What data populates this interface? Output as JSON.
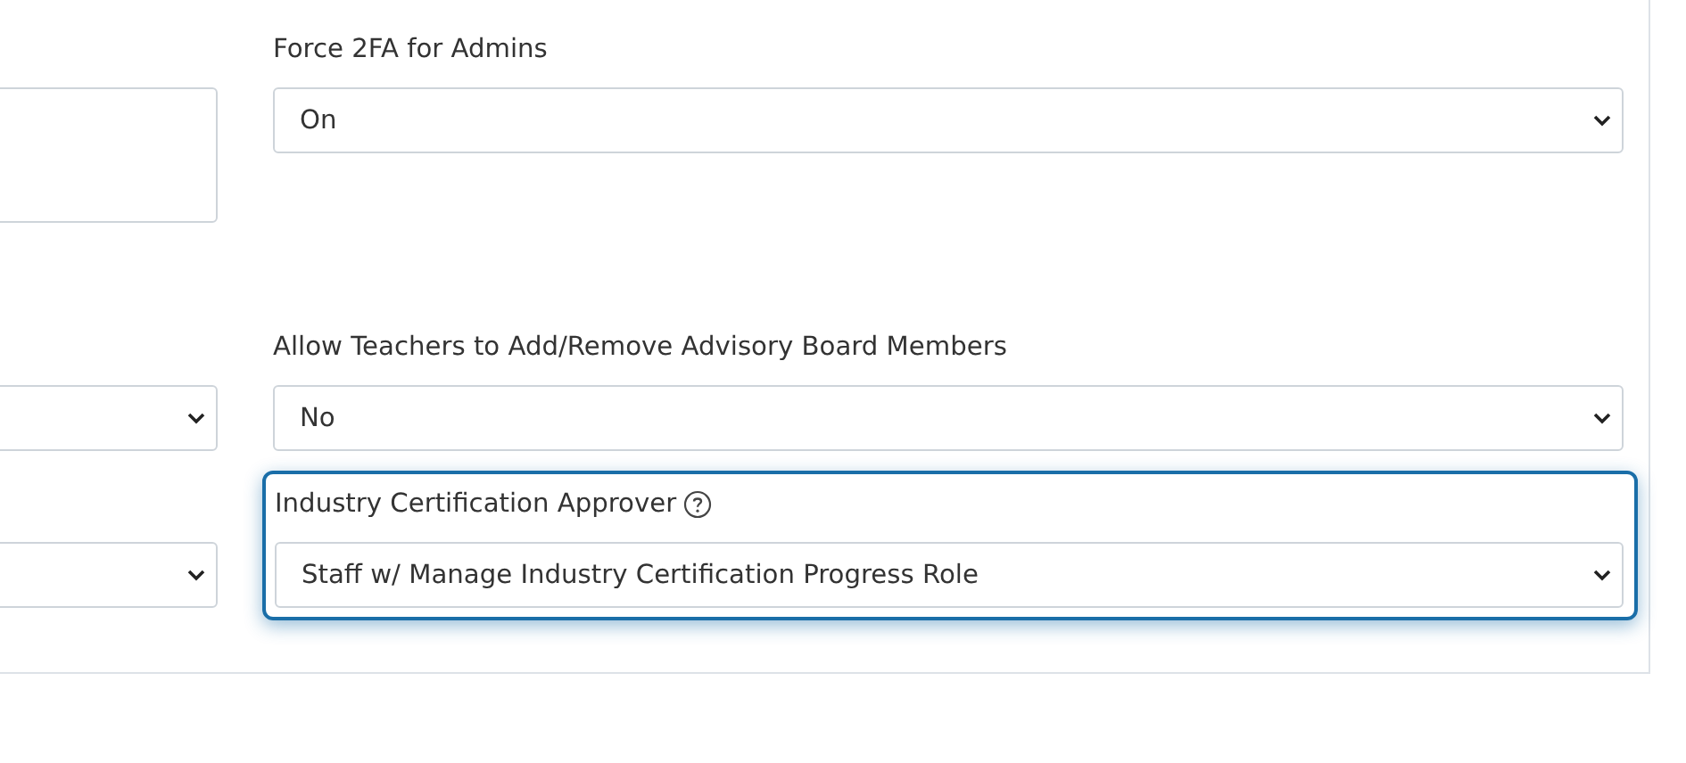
{
  "rows": [
    {
      "left": {
        "kind": "textarea"
      },
      "right": {
        "label": "Force 2FA for Admins",
        "value": "On",
        "help": false,
        "focused": false
      }
    },
    {
      "left": {
        "kind": "select"
      },
      "right": {
        "label": "Allow Teachers to Add/Remove Advisory Board Members",
        "value": "No",
        "help": false,
        "focused": false
      }
    },
    {
      "left": {
        "kind": "select"
      },
      "right": {
        "label": "Industry Certification Approver",
        "value": "Staff w/ Manage Industry Certification Progress Role",
        "help": true,
        "focused": true
      }
    }
  ]
}
